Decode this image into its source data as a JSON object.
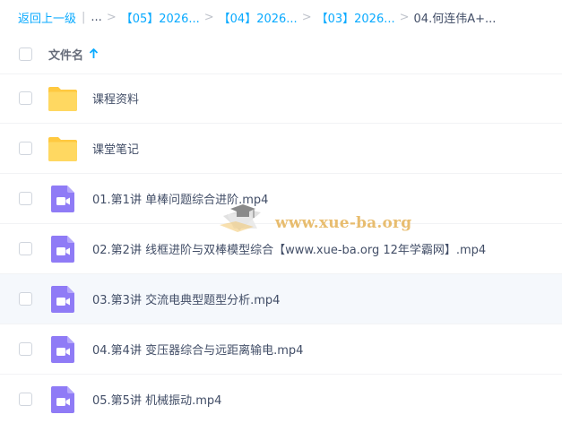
{
  "breadcrumb": {
    "back": "返回上一级",
    "ellipsis": "...",
    "items": [
      "【05】2026...",
      "【04】2026...",
      "【03】2026..."
    ],
    "current": "04.何连伟A+..."
  },
  "header": {
    "column_name": "文件名"
  },
  "files": [
    {
      "name": "课程资料",
      "type": "folder-icon"
    },
    {
      "name": "课堂笔记",
      "type": "folder-icon"
    },
    {
      "name": "01.第1讲 单棒问题综合进阶.mp4",
      "type": "video-icon"
    },
    {
      "name": "02.第2讲 线框进阶与双棒模型综合【www.xue-ba.org 12年学霸网】.mp4",
      "type": "video-icon"
    },
    {
      "name": "03.第3讲 交流电典型题型分析.mp4",
      "type": "video-icon"
    },
    {
      "name": "04.第4讲 变压器综合与远距离输电.mp4",
      "type": "video-icon"
    },
    {
      "name": "05.第5讲 机械振动.mp4",
      "type": "video-icon"
    }
  ],
  "watermark": {
    "text": "www.xue-ba.org"
  },
  "colors": {
    "link": "#09aaff",
    "folder": "#ffd55c",
    "video": "#8f7bf6",
    "highlight_row": "#f5f8fc"
  }
}
